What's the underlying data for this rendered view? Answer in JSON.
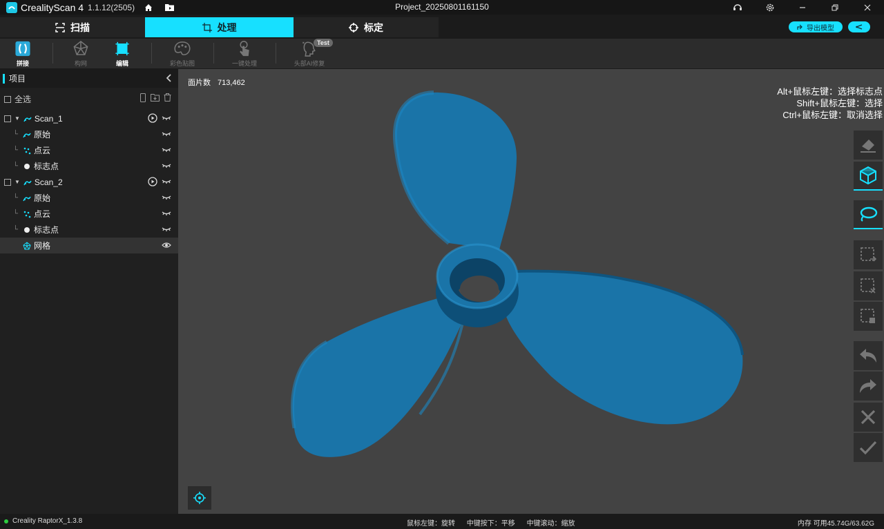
{
  "titlebar": {
    "app_name": "CrealityScan 4",
    "version": "1.1.12(2505)",
    "project": "Project_20250801161150"
  },
  "modes": [
    {
      "label": "扫描",
      "icon": "scan-frame-icon"
    },
    {
      "label": "处理",
      "icon": "crop-icon"
    },
    {
      "label": "标定",
      "icon": "target-icon"
    }
  ],
  "active_mode": "处理",
  "topright": {
    "export_label": "导出模型"
  },
  "tools": [
    {
      "label": "拼接",
      "icon": "stitch-icon",
      "enabled": true
    },
    {
      "label": "构网",
      "icon": "mesh-build-icon",
      "enabled": false
    },
    {
      "label": "编辑",
      "icon": "edit-icon",
      "enabled": true
    },
    {
      "label": "彩色贴图",
      "icon": "palette-icon",
      "enabled": false
    },
    {
      "label": "一键处理",
      "icon": "one-click-icon",
      "enabled": false
    },
    {
      "label": "头部AI修复",
      "icon": "head-ai-icon",
      "enabled": false
    }
  ],
  "test_badge": "Test",
  "sidebar": {
    "title": "项目",
    "select_all": "全选",
    "tree": [
      {
        "label": "Scan_1",
        "level": 0
      },
      {
        "label": "原始",
        "level": 1
      },
      {
        "label": "点云",
        "level": 1
      },
      {
        "label": "标志点",
        "level": 1
      },
      {
        "label": "Scan_2",
        "level": 0
      },
      {
        "label": "原始",
        "level": 1
      },
      {
        "label": "点云",
        "level": 1
      },
      {
        "label": "标志点",
        "level": 1
      },
      {
        "label": "网格",
        "level": 0
      }
    ]
  },
  "viewport": {
    "face_label": "面片数",
    "face_count": "713,462",
    "hints": [
      "Alt+鼠标左键：选择标志点",
      "Shift+鼠标左键：选择",
      "Ctrl+鼠标左键：取消选择"
    ],
    "model_color": "#1a74a8"
  },
  "side_tools": [
    "eraser-icon",
    "cube-icon",
    "lasso-icon",
    "invert-selection-icon",
    "clear-selection-icon",
    "delete-selection-icon",
    "undo-icon",
    "redo-icon",
    "cancel-icon",
    "confirm-icon"
  ],
  "status": {
    "engine": "Creality RaptorX_1.3.8",
    "hints": [
      "鼠标左键：旋转",
      "中键按下：平移",
      "中键滚动：缩放"
    ],
    "memory": "内存 可用45.74G/63.62G"
  },
  "colors": {
    "accent": "#17e0ff",
    "status_ok": "#2ecc40"
  }
}
